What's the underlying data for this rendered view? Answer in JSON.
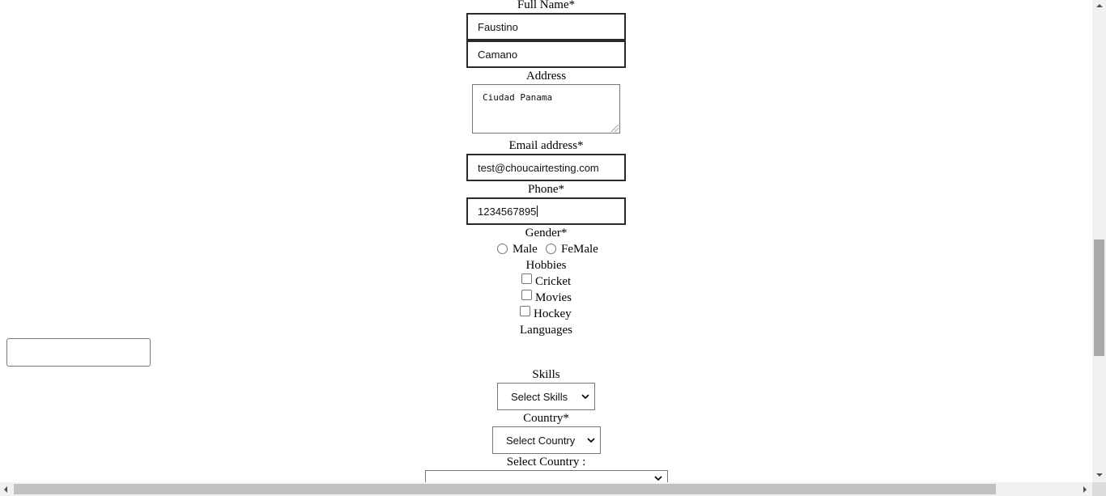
{
  "form": {
    "full_name_label": "Full Name*",
    "first_name_value": "Faustino",
    "last_name_value": "Camano",
    "address_label": "Address",
    "address_value": "Ciudad Panama",
    "email_label": "Email address*",
    "email_value": "test@choucairtesting.com",
    "phone_label": "Phone*",
    "phone_value": "1234567895",
    "gender_label": "Gender*",
    "gender_options": [
      "Male",
      "FeMale"
    ],
    "hobbies_label": "Hobbies",
    "hobbies_options": [
      "Cricket",
      "Movies",
      "Hockey"
    ],
    "languages_label": "Languages",
    "skills_label": "Skills",
    "skills_selected": "Select Skills",
    "country_label": "Country*",
    "country_selected": "Select Country",
    "select_country_label": "Select Country :",
    "select_country_value": ""
  },
  "icons": {
    "select_arrow": "chevron-down-icon",
    "resize": "resize-grip-icon"
  },
  "colors": {
    "input_border": "#2a2a2a",
    "scroll_track": "#f1f1f1",
    "scroll_thumb": "#a8a8a8"
  }
}
